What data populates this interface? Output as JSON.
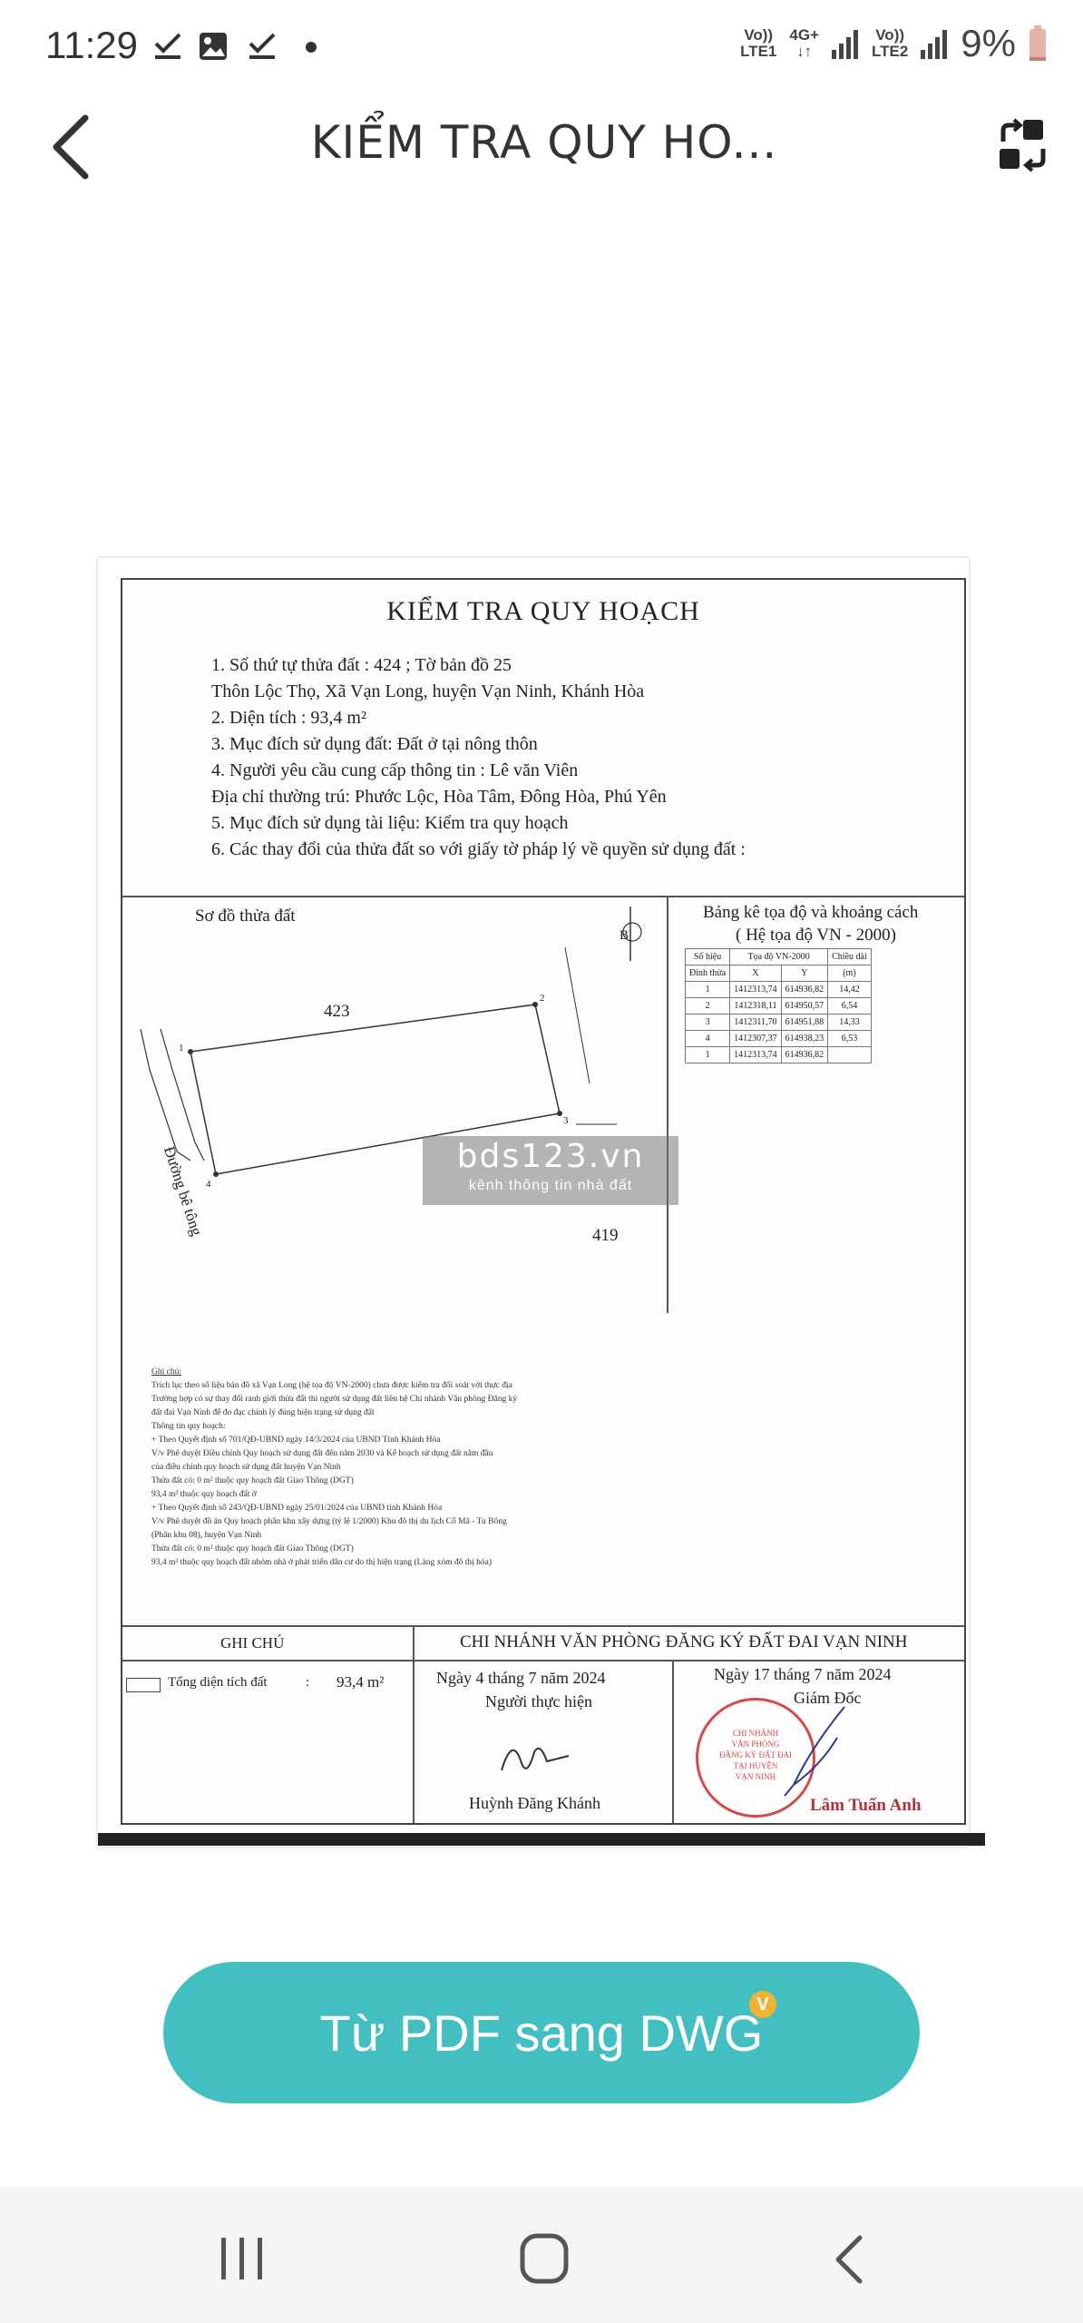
{
  "status_bar": {
    "time": "11:29",
    "left_icons": [
      "check-download-icon",
      "image-icon",
      "check-download-icon",
      "dot-icon"
    ],
    "network1_top": "Vo)) ",
    "network1_bottom": "LTE1",
    "network_type_top": "4G+",
    "network_type_bottom": "↓↑",
    "network2_top": "Vo))",
    "network2_bottom": "LTE2",
    "battery": "9%"
  },
  "header": {
    "title": "KIỂM TRA QUY HO...",
    "back_icon": "back-arrow-icon",
    "action_icon": "convert-icon"
  },
  "document": {
    "title": "KIỂM TRA QUY HOẠCH",
    "info_lines": [
      "1. Số thứ tự thửa đất : 424 ;  Tờ bản đồ 25",
      "    Thôn Lộc Thọ, Xã Vạn Long, huyện Vạn Ninh, Khánh Hòa",
      "2. Diện tích :  93,4 m²",
      "3. Mục đích sử dụng đất:  Đất ở tại nông thôn",
      "4. Người yêu cầu cung cấp thông tin : Lê văn Viên",
      "    Địa chỉ thường trú: Phước Lộc, Hòa Tâm, Đông Hòa, Phú Yên",
      "5. Mục đích sử dụng tài liệu: Kiểm tra quy hoạch",
      "6. Các thay đổi của thửa đất so với giấy tờ pháp lý về quyền sử dụng đất :"
    ],
    "map": {
      "label": "Sơ đồ thửa đất",
      "north": "B",
      "parcel_north": "423",
      "parcel_south": "419",
      "road_label": "Đường bê tông",
      "vertices": [
        "1",
        "2",
        "3",
        "4"
      ]
    },
    "coords": {
      "title": "Bảng kê tọa độ và khoảng cách",
      "subtitle": "( Hệ tọa độ VN - 2000)",
      "col_vertex_1": "Số hiệu",
      "col_vertex_2": "Đỉnh thửa",
      "col_coord": "Tọa độ VN-2000",
      "col_x": "X",
      "col_y": "Y",
      "col_len_1": "Chiều dài",
      "col_len_2": "(m)",
      "rows": [
        {
          "v": "1",
          "x": "1412313,74",
          "y": "614936,82"
        },
        {
          "v": "2",
          "x": "1412318,11",
          "y": "614950,57"
        },
        {
          "v": "3",
          "x": "1412311,70",
          "y": "614951,88"
        },
        {
          "v": "4",
          "x": "1412307,37",
          "y": "614938,23"
        },
        {
          "v": "1",
          "x": "1412313,74",
          "y": "614936,82"
        }
      ],
      "lengths": [
        "14,42",
        "6,54",
        "14,33",
        "6,53"
      ]
    },
    "notes": {
      "heading": "Ghi chú:",
      "lines": [
        "Trích lục theo số liệu bản đồ xã Vạn Long (hệ tọa độ VN-2000) chưa được kiểm tra đối soát với thực địa",
        "Trường hợp có sự thay đổi ranh giới thửa đất thì người sử dụng đất liên hệ Chi nhánh Văn phòng Đăng ký",
        "đất đai Vạn Ninh để đo đạc chỉnh lý đúng hiện trạng sử dụng đất",
        "Thông tin quy hoạch:",
        "+ Theo Quyết định số 701/QĐ-UBND ngày 14/3/2024 của UBND Tỉnh Khánh Hòa",
        "V/v Phê duyệt Điều chỉnh Quy hoạch sử dụng đất đến năm 2030 và Kế hoạch sử dụng đất năm đầu",
        "của điều chỉnh quy hoạch sử dụng đất huyện Vạn Ninh",
        "Thửa đất có:      0 m² thuộc quy hoạch đất Giao Thông  (DGT)",
        "                  93,4 m² thuộc quy hoạch đất ở",
        "+ Theo Quyết định số  243/QĐ-UBND ngày 25/01/2024 của UBND tỉnh Khánh Hòa",
        "V/v Phê duyệt đồ án Quy hoạch phân khu xây dựng (tỷ lệ 1/2000) Khu đô thị du lịch Cổ Mã - Tu Bông",
        "(Phân khu 08), huyện Vạn Ninh",
        "Thửa đất có:      0 m² thuộc quy hoạch đất Giao Thông  (DGT)",
        "                  93,4 m² thuộc quy hoạch đất nhóm nhà ở phát triển dân cư do thị hiện trạng (Làng xóm đô thị hóa)"
      ]
    },
    "footer": {
      "ghi_chu": "GHI CHÚ",
      "office": "CHI NHÁNH VĂN PHÒNG ĐĂNG KÝ ĐẤT ĐAI VẠN NINH",
      "total_label": "Tổng diện tích đất",
      "total_colon": ":",
      "total_value": "93,4  m²",
      "date1": "Ngày 4 tháng 7  năm  2024",
      "person1_role": "Người thực hiện",
      "person1_name": "Huỳnh Đăng Khánh",
      "date2": "Ngày 17 tháng 7  năm  2024",
      "person2_role": "Giám Đốc",
      "person2_name": "Lâm Tuấn Anh",
      "stamp_lines": [
        "CHI NHÁNH",
        "VĂN PHÒNG",
        "ĐĂNG KÝ ĐẤT ĐAI",
        "TẠI HUYỆN",
        "VẠN NINH"
      ]
    }
  },
  "watermark": {
    "big": "bds123.vn",
    "small": "kênh thông tin nhà đất"
  },
  "convert_button": {
    "label": "Từ PDF sang DWG",
    "badge": "V",
    "color": "#43bfc1"
  },
  "navbar": {
    "items": [
      "recent-apps-icon",
      "home-icon",
      "back-icon"
    ]
  }
}
